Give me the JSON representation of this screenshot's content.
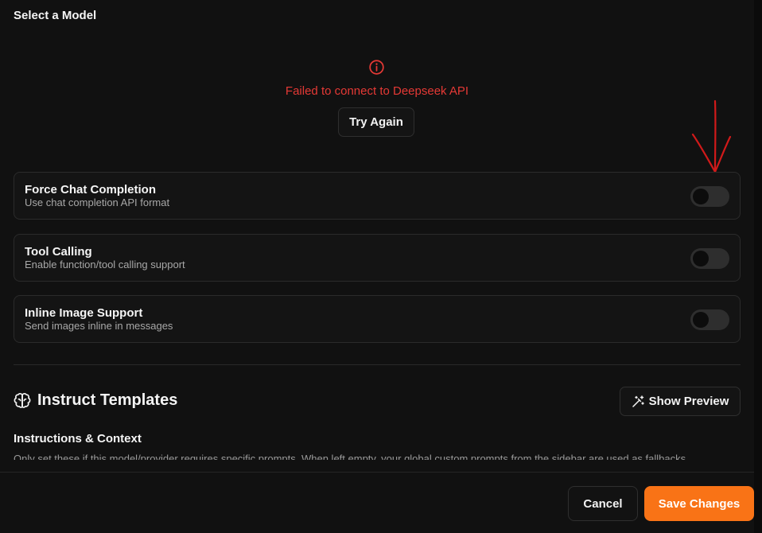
{
  "model_section": {
    "title": "Select a Model",
    "error_message": "Failed to connect to Deepseek API",
    "try_again_label": "Try Again",
    "error_icon": "info-circle-icon"
  },
  "settings": [
    {
      "name": "Force Chat Completion",
      "description": "Use chat completion API format",
      "enabled": false
    },
    {
      "name": "Tool Calling",
      "description": "Enable function/tool calling support",
      "enabled": false
    },
    {
      "name": "Inline Image Support",
      "description": "Send images inline in messages",
      "enabled": false
    }
  ],
  "instruct_templates": {
    "title": "Instruct Templates",
    "icon": "brain-icon",
    "show_preview_label": "Show Preview",
    "show_preview_icon": "magic-wand-icon",
    "subtitle": "Instructions & Context",
    "description": "Only set these if this model/provider requires specific prompts. When left empty, your global custom prompts from the sidebar are used as fallbacks."
  },
  "footer": {
    "cancel_label": "Cancel",
    "save_label": "Save Changes"
  },
  "colors": {
    "background": "#111111",
    "error": "#e53935",
    "accent": "#f97316",
    "annotation": "#d11a1a"
  }
}
